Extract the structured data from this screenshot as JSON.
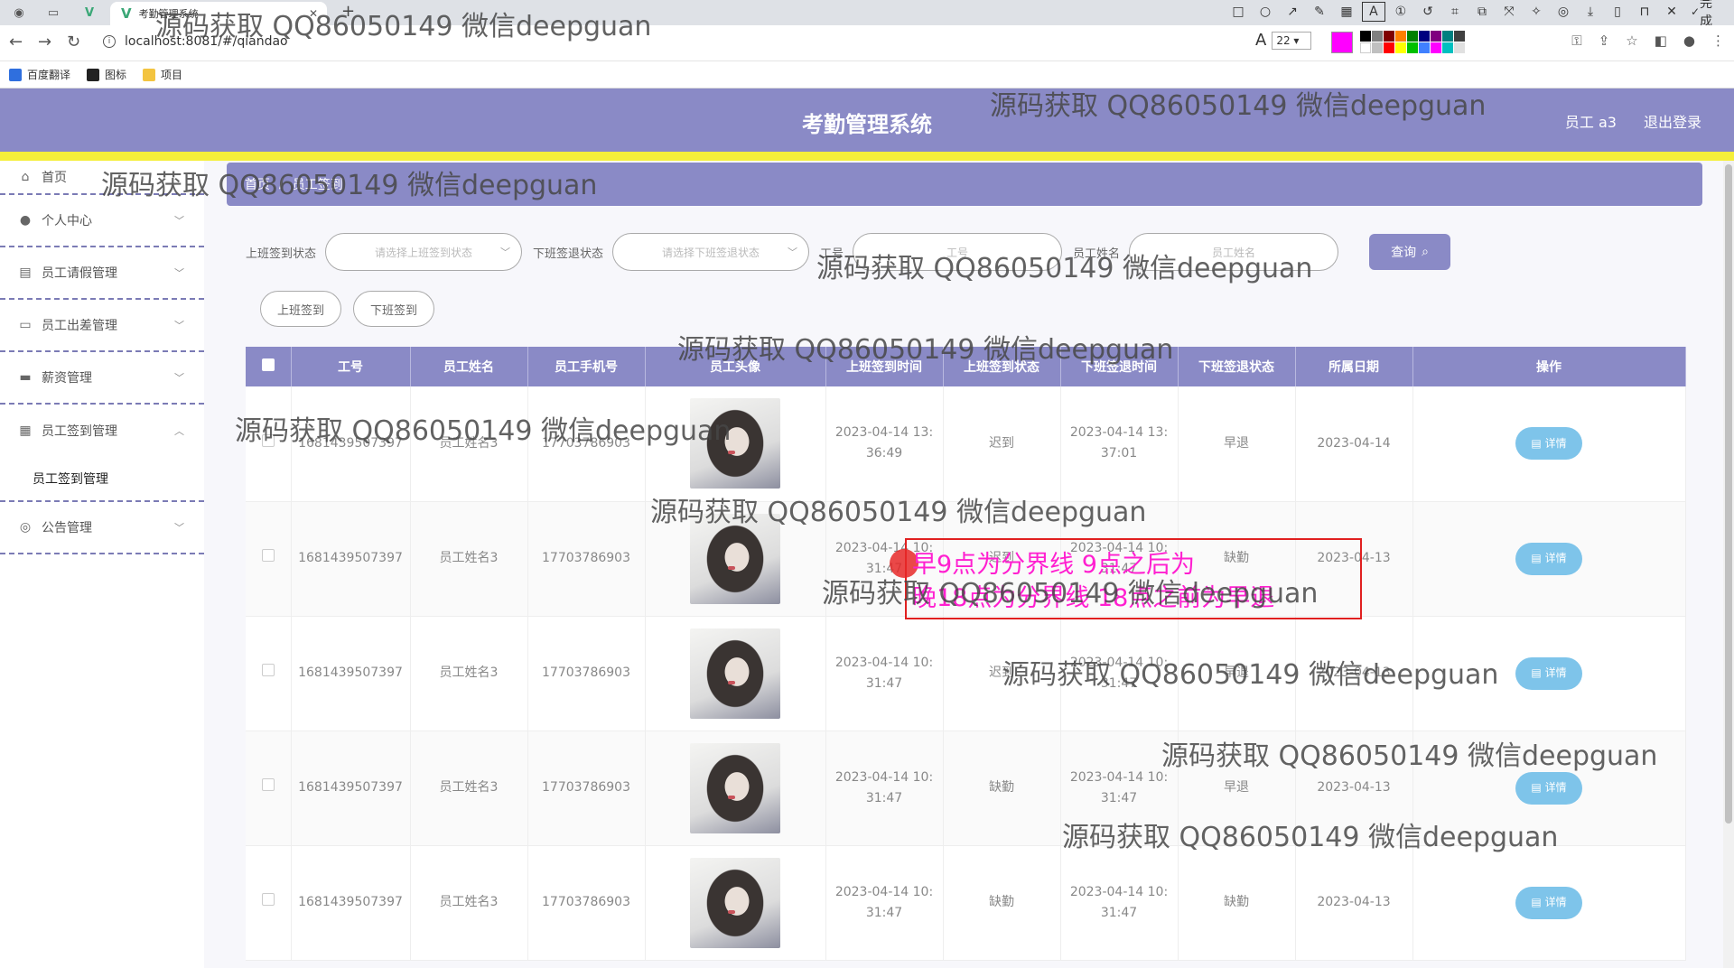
{
  "browser": {
    "tab_title": "考勤管理系统",
    "url": "localhost:8081/#/qiandao",
    "bookmarks": [
      "百度翻译",
      "图标",
      "项目"
    ],
    "annotation_toolbar": {
      "font_size": "22",
      "done_label": "完成",
      "active_color": "#ff00ff"
    }
  },
  "header": {
    "title": "考勤管理系统",
    "user_label": "员工 a3",
    "logout_label": "退出登录",
    "colors": {
      "primary": "#8a8ac6",
      "stripe": "#f5ef3a"
    }
  },
  "sidebar": {
    "items": [
      {
        "label": "首页",
        "icon": "home-icon"
      },
      {
        "label": "个人中心",
        "icon": "user-icon"
      },
      {
        "label": "员工请假管理",
        "icon": "chart-icon"
      },
      {
        "label": "员工出差管理",
        "icon": "chat-icon"
      },
      {
        "label": "薪资管理",
        "icon": "monitor-icon"
      },
      {
        "label": "员工签到管理",
        "icon": "grid-icon"
      },
      {
        "label": "公告管理",
        "icon": "compass-icon"
      }
    ],
    "sub_item": "员工签到管理"
  },
  "breadcrumb": {
    "home": "首页",
    "current": "员工签到"
  },
  "filters": {
    "checkin_label": "上班签到状态",
    "checkin_placeholder": "请选择上班签到状态",
    "checkout_label": "下班签退状态",
    "checkout_placeholder": "请选择下班签退状态",
    "id_label": "工号",
    "id_placeholder": "工号",
    "name_label": "员工姓名",
    "name_placeholder": "员工姓名",
    "query_label": "查询"
  },
  "actions": {
    "checkin": "上班签到",
    "checkout": "下班签到"
  },
  "table": {
    "headers": [
      "工号",
      "员工姓名",
      "员工手机号",
      "员工头像",
      "上班签到时间",
      "上班签到状态",
      "下班签退时间",
      "下班签退状态",
      "所属日期",
      "操作"
    ],
    "detail_label": "详情",
    "rows": [
      {
        "id": "1681439507397",
        "name": "员工姓名3",
        "phone": "17703786903",
        "in_time": "2023-04-14 13:36:49",
        "in_status": "迟到",
        "out_time": "2023-04-14 13:37:01",
        "out_status": "早退",
        "date": "2023-04-14"
      },
      {
        "id": "1681439507397",
        "name": "员工姓名3",
        "phone": "17703786903",
        "in_time": "2023-04-14 10:31:47",
        "in_status": "迟到",
        "out_time": "2023-04-14 10:31:47",
        "out_status": "缺勤",
        "date": "2023-04-13"
      },
      {
        "id": "1681439507397",
        "name": "员工姓名3",
        "phone": "17703786903",
        "in_time": "2023-04-14 10:31:47",
        "in_status": "迟到",
        "out_time": "2023-04-14 10:31:47",
        "out_status": "早退",
        "date": "2023-04-13"
      },
      {
        "id": "1681439507397",
        "name": "员工姓名3",
        "phone": "17703786903",
        "in_time": "2023-04-14 10:31:47",
        "in_status": "缺勤",
        "out_time": "2023-04-14 10:31:47",
        "out_status": "早退",
        "date": "2023-04-13"
      },
      {
        "id": "1681439507397",
        "name": "员工姓名3",
        "phone": "17703786903",
        "in_time": "2023-04-14 10:31:47",
        "in_status": "缺勤",
        "out_time": "2023-04-14 10:31:47",
        "out_status": "缺勤",
        "date": "2023-04-13"
      }
    ]
  },
  "annotation_note": {
    "line1": "早9点为分界线 9点之后为",
    "line2": "晚18点为分界线  18点之前为早退"
  },
  "watermark_text": "源码获取 QQ86050149 微信deepguan"
}
